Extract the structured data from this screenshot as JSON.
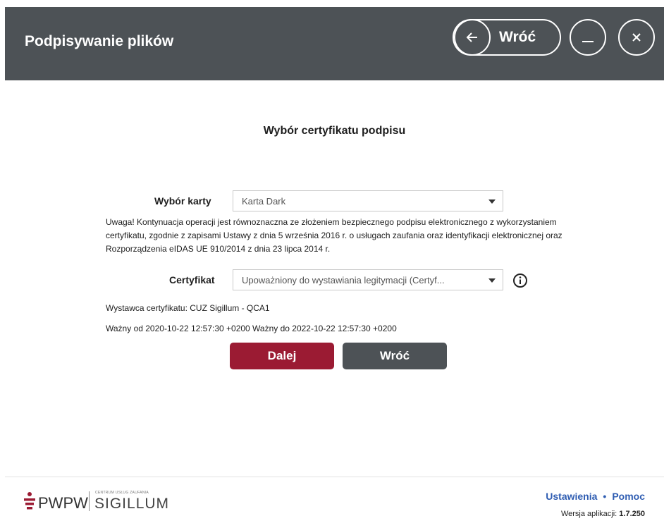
{
  "header": {
    "title": "Podpisywanie plików",
    "back_label": "Wróć"
  },
  "main": {
    "section_title": "Wybór certyfikatu podpisu",
    "card_label": "Wybór karty",
    "card_value": "Karta Dark",
    "warning_text": "Uwaga! Kontynuacja operacji jest równoznaczna ze złożeniem bezpiecznego podpisu elektronicznego z wykorzystaniem certyfikatu, zgodnie z zapisami Ustawy z dnia 5 września 2016 r. o usługach zaufania oraz identyfikacji elektronicznej oraz Rozporządzenia eIDAS UE 910/2014 z dnia 23 lipca 2014 r.",
    "certificate_label": "Certyfikat",
    "certificate_value": "Upoważniony do wystawiania legitymacji (Certyf...",
    "issuer_text": "Wystawca certyfikatu: CUZ Sigillum - QCA1",
    "validity_text": "Ważny od 2020-10-22 12:57:30 +0200 Ważny do 2022-10-22 12:57:30 +0200",
    "next_label": "Dalej",
    "back_label": "Wróć"
  },
  "footer": {
    "logo_text": "PWPW",
    "logo_small": "CENTRUM USŁUG ZAUFANIA",
    "logo_brand": "SIGILLUM",
    "settings_label": "Ustawienia",
    "separator": "•",
    "help_label": "Pomoc",
    "version_label": "Wersja aplikacji:",
    "version_value": "1.7.250"
  },
  "colors": {
    "header_bg": "#4d5256",
    "primary": "#9b1b33",
    "link": "#2f5db2"
  },
  "icons": [
    "arrow-left-icon",
    "minimize-icon",
    "close-icon",
    "info-icon",
    "chevron-down-icon"
  ]
}
